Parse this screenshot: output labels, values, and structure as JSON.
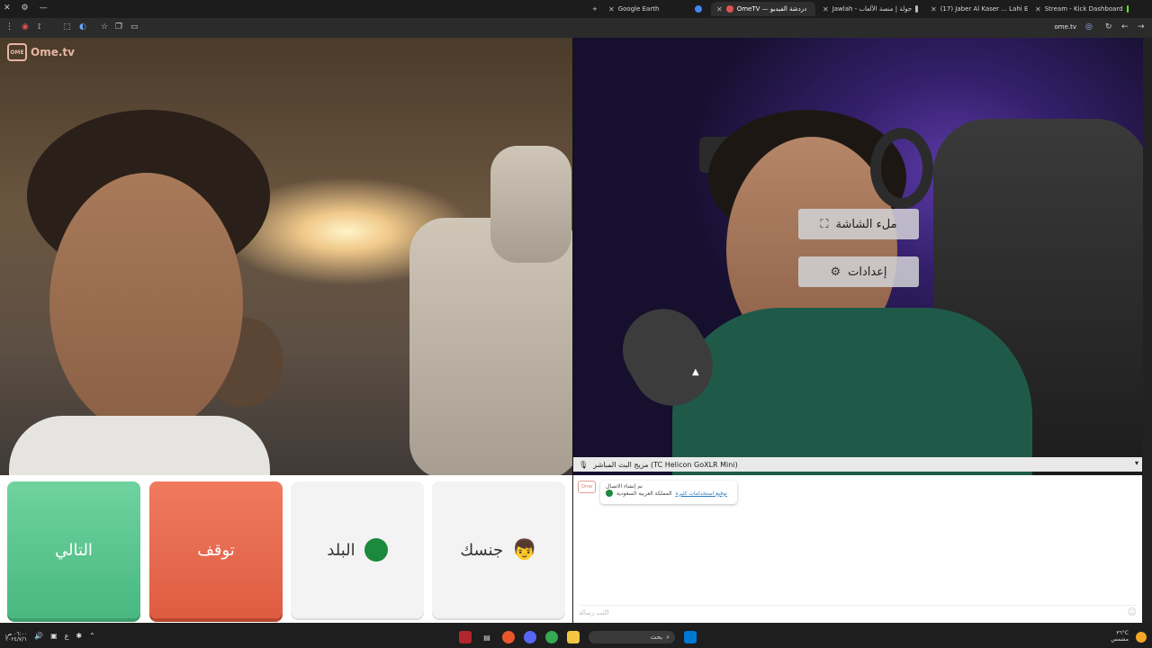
{
  "browser": {
    "tabs": [
      {
        "label": "Google Earth",
        "color": "#4285f4"
      },
      {
        "label": "OmeTV — دردشة الفيديو",
        "color": "#e05252",
        "active": true
      },
      {
        "label": "Jawlah - جولة | منصة الألعاب",
        "color": "#bdbdbd"
      },
      {
        "label": "(17) Jaber Al Kaser ... Lahi Ent",
        "color": "#ff0000"
      },
      {
        "label": "Stream - Kick Dashboard",
        "color": "#53fc18"
      }
    ],
    "new_tab": "+",
    "address": "ome.tv"
  },
  "site": {
    "logo_text": "Ome.tv",
    "logo_box": "OME"
  },
  "overlay": {
    "fullscreen_label": "ملء الشاشة",
    "settings_label": "إعدادات"
  },
  "mic": {
    "label": "مزيج البث المباشر (TC Helicon GoXLR Mini)"
  },
  "controls": {
    "next_label": "التالي",
    "stop_label": "توقف",
    "country_label": "البلد",
    "gender_label": "جنسك",
    "country_flag": "SA"
  },
  "chat": {
    "avatar": "Ome",
    "line1": "تم إنشاء الاتصال",
    "country": "المملكة العربية السعودية",
    "link": "توقيع استخدامات كثيرة",
    "input_placeholder": "اكتب رسالة"
  },
  "taskbar": {
    "search_label": "بحث",
    "time": "٠٦:٠٠ ص",
    "date": "٢٠٢٤/٧/٦",
    "lang": "ع",
    "weather": "٣٦°C",
    "weather_text": "مشمس"
  }
}
